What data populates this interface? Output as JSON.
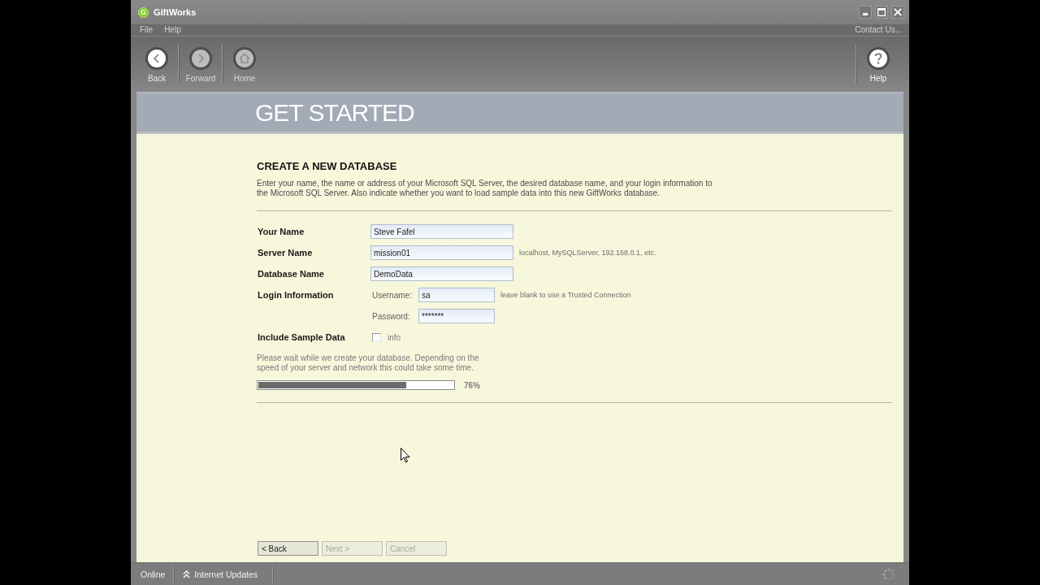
{
  "window": {
    "title": "GiftWorks",
    "logo_text": "G"
  },
  "menu_bar": {
    "items": [
      "File",
      "Help"
    ],
    "link": "Contact Us..."
  },
  "toolbar": {
    "buttons": [
      {
        "kind": "back",
        "label": "Back",
        "disabled": false
      },
      {
        "kind": "forward",
        "label": "Forward",
        "disabled": true
      },
      {
        "kind": "home",
        "label": "Home",
        "disabled": true
      }
    ],
    "help": {
      "label": "Help"
    }
  },
  "header": {
    "title": "GET STARTED"
  },
  "form": {
    "heading": "CREATE A NEW DATABASE",
    "description": "Enter your name, the name or address of your Microsoft SQL Server, the desired database name, and your login information to the Microsoft SQL Server. Also indicate whether you want to load sample data into this new GiftWorks database.",
    "fields": [
      {
        "kind": "text",
        "label": "Your Name",
        "value": "Steve Fafel"
      },
      {
        "kind": "text",
        "label": "Server Name",
        "value": "mission01",
        "hint": "localhost, MySQLServer, 192.168.0.1, etc."
      },
      {
        "kind": "text",
        "label": "Database Name",
        "value": "DemoData"
      },
      {
        "kind": "login",
        "label": "Login Information",
        "username_label": "Username:",
        "username": "sa",
        "hint": "leave blank to use a Trusted Connection",
        "password_label": "Password:",
        "password": "*******"
      },
      {
        "kind": "checkbox",
        "label": "Include Sample Data",
        "checked": false,
        "link": "info"
      }
    ],
    "progress": {
      "message": "Please wait while we create your database. Depending on the speed of your server and network this could take some time.",
      "level": 0.76,
      "reading": "76%"
    },
    "buttons": [
      {
        "label": "< Back",
        "disabled": false
      },
      {
        "label": "Next >",
        "disabled": true
      },
      {
        "label": "Cancel",
        "disabled": true
      }
    ]
  },
  "status_bar": {
    "items": [
      {
        "kind": "status",
        "label": "Online"
      },
      {
        "kind": "updates",
        "label": "Internet Updates"
      }
    ]
  }
}
